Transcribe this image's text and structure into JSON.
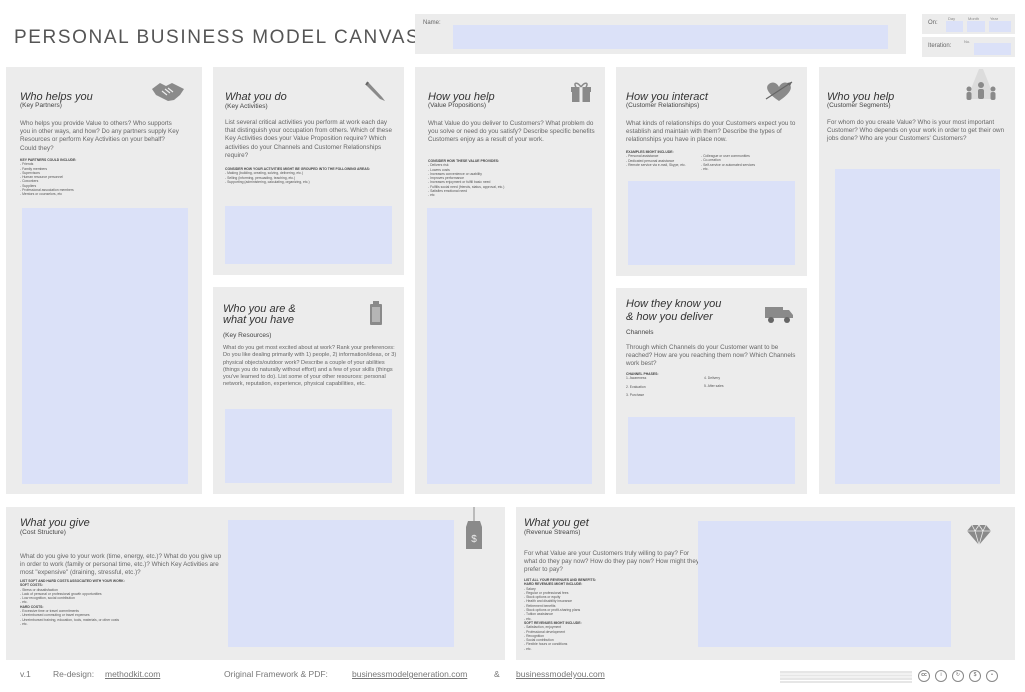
{
  "header": {
    "title": "PERSONAL BUSINESS MODEL CANVAS OF",
    "name_label": "Name:",
    "on_label": "On:",
    "iteration_label": "Iteration:",
    "date_labels": [
      "Day",
      "Month",
      "Year"
    ],
    "iteration_no_label": "No."
  },
  "key_partners": {
    "title": "Who helps you",
    "subtitle": "(Key Partners)",
    "description": "Who helps you provide Value to others? Who supports you in other ways, and how? Do any partners supply Key Resources or perform Key Activities on your behalf? Could they?",
    "list_header": "KEY PARTNERS COULD INCLUDE:",
    "list": [
      "- Friends",
      "- Family members",
      "- Supervisors",
      "- Human resource personnel",
      "- Coworkers",
      "- Suppliers",
      "- Professional association members",
      "- Mentors or counselors, etc"
    ]
  },
  "key_activities": {
    "title": "What you do",
    "subtitle": "(Key Activities)",
    "description": "List several critical activities you perform at work each day that distinguish your occupation from others. Which of these Key Activities does your Value Proposition require? Which activities do your Channels and Customer Relationships require?",
    "list_header": "CONSIDER HOW YOUR ACTIVITIES MIGHT BE GROUPED INTO THE FOLLOWING AREAS:",
    "list": [
      "- Making (building, creating, solving, delivering, etc.)",
      "- Selling (informing, persuading, teaching, etc.)",
      "- Supporting (administering, calculating, organizing, etc.)"
    ]
  },
  "key_resources": {
    "title_line1": "Who you are &",
    "title_line2": "what you have",
    "subtitle": "(Key Resources)",
    "description": "What do you get most excited about at work? Rank your preferences: Do you like dealing primarily with 1) people, 2) information/ideas, or 3) physical objects/outdoor work? Describe a couple of your abilities (things you do naturally without effort) and a few of your skills (things you've learned to do). List some of your other resources: personal network, reputation, experience, physical capabilities, etc."
  },
  "value_propositions": {
    "title": "How you help",
    "subtitle": "(Value Propositions)",
    "description": "What Value do you deliver to Customers? What problem do you solve or need do you satisfy? Describe specific benefits Customers enjoy as a result of your work.",
    "list_header": "CONSIDER HOW THESE VALUE PROVIDES:",
    "list": [
      "- Delivers risk",
      "- Lowers costs",
      "- Increases convenience or usability",
      "- Improves performance",
      "- Increases enjoyment or fulfill basic need",
      "- Fulfills social need (friends, status, approval, etc.)",
      "- Satisfies emotional need",
      "- etc"
    ]
  },
  "customer_relationships": {
    "title": "How you interact",
    "subtitle": "(Customer Relationships)",
    "description": "What kinds of relationships do your Customers expect you to establish and maintain with them? Describe the types of relationships you have in place now.",
    "list_header": "EXAMPLES MIGHT INCLUDE:",
    "list_left": [
      "- Personal assistance",
      "- Dedicated personal assistance",
      "- Remote service via e-mail, Skype, etc."
    ],
    "list_right": [
      "- Colleague or user communities",
      "- Co-creation",
      "- Self-service or automated services",
      "- etc."
    ]
  },
  "channels": {
    "title_line1": "How they know you",
    "title_line2": "& how you deliver",
    "subtitle": "Channels",
    "description": "Through which Channels do your Customer want to be reached? How are you reaching them now? Which Channels work best?",
    "list_header": "CHANNEL PHASES:",
    "phases": [
      "1. Awareness",
      "2. Evaluation",
      "3. Purchase",
      "4. Delivery",
      "5. After sales"
    ]
  },
  "customer_segments": {
    "title": "Who you help",
    "subtitle": "(Customer Segments)",
    "description": "For whom do you create Value? Who is your most important Customer? Who depends on your work in order to get their own jobs done? Who are your Customers' Customers?"
  },
  "cost_structure": {
    "title": "What you give",
    "subtitle": "(Cost Structure)",
    "description": "What do you give to your work (time, energy, etc.)? What do you give up in order to work (family or personal time, etc.)? Which Key Activities are most \"expensive\" (draining, stressful, etc.)?",
    "list_header": "LIST SOFT AND HARD COSTS ASSOCIATED WITH YOUR WORK:",
    "soft_header": "SOFT COSTS:",
    "soft": [
      "- Stress or dissatisfaction",
      "- Lack of personal or professional growth opportunities",
      "- Low recognition, social contribution",
      "- etc."
    ],
    "hard_header": "HARD COSTS:",
    "hard": [
      "- Excessive time or travel commitments",
      "- Unreimbursed commuting or travel expenses",
      "- Unreimbursed training, education, tools, materials, or other costs",
      "- etc."
    ]
  },
  "revenue_streams": {
    "title": "What you get",
    "subtitle": "(Revenue Streams)",
    "description": "For what Value are your Customers truly willing to pay? For what do they pay now? How do they pay now? How might they prefer to pay?",
    "list_header": "LIST ALL YOUR REVENUES AND BENEFITS:",
    "hard_header": "HARD REVENUES MIGHT INCLUDE:",
    "hard": [
      "- Salary",
      "- Regular or professional fees",
      "- Stock options or equity",
      "- Health and disability insurance",
      "- Retirement benefits",
      "- Stock options or profit-sharing plans",
      "- Tuition assistance",
      "- etc."
    ],
    "soft_header": "SOFT REVENUES MIGHT INCLUDE:",
    "soft": [
      "- Satisfaction, enjoyment",
      "- Professional development",
      "- Recognition",
      "- Social contribution",
      "- Flexible hours or conditions",
      "- etc."
    ]
  },
  "footer": {
    "version": "v.1",
    "redesign_label": "Re-design:",
    "redesign_link": "methodkit.com",
    "original_label": "Original Framework & PDF:",
    "original_link": "businessmodelgeneration.com",
    "amp": "&",
    "you_link": "businessmodelyou.com"
  }
}
